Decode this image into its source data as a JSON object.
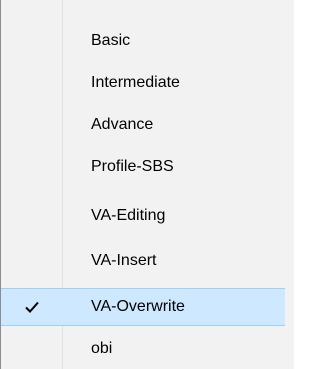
{
  "menu": {
    "items": [
      {
        "label": "Basic",
        "checked": false
      },
      {
        "label": "Intermediate",
        "checked": false
      },
      {
        "label": "Advance",
        "checked": false
      },
      {
        "label": "Profile-SBS",
        "checked": false
      },
      {
        "label": "VA-Editing",
        "checked": false
      },
      {
        "label": "VA-Insert",
        "checked": false
      },
      {
        "label": "VA-Overwrite",
        "checked": true
      },
      {
        "label": "obi",
        "checked": false
      }
    ],
    "check_icon": "checkmark-icon",
    "colors": {
      "background": "#f2f2f2",
      "selected_background": "#cde8ff",
      "selected_border": "#99d1ff"
    }
  }
}
